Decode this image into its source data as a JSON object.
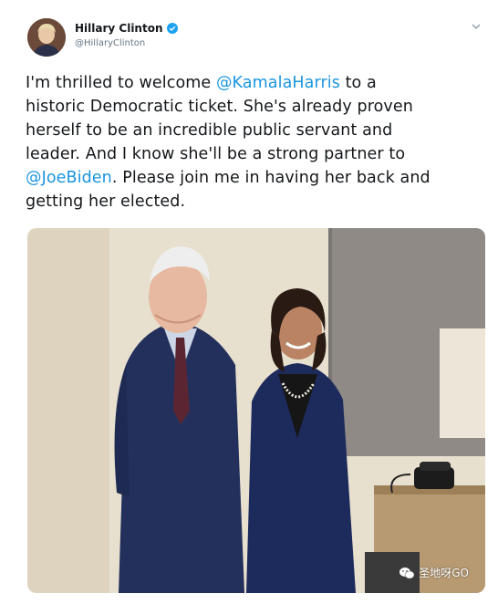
{
  "author": {
    "name": "Hillary Clinton",
    "handle": "@HillaryClinton"
  },
  "tweet": {
    "line1_a": "I'm thrilled to welcome ",
    "mention_1": "@KamalaHarris",
    "line1_b": " to a",
    "line2": "historic Democratic ticket. She's already proven",
    "line3": "herself to be an incredible public servant and",
    "line4": "leader. And I know she'll be a strong partner to",
    "mention_2": "@JoeBiden",
    "line5_b": ". Please join me in having her back and",
    "line6": "getting her elected."
  },
  "watermark": {
    "text": "圣地呀GO"
  },
  "colors": {
    "mention": "#1b95e0",
    "verified": "#1da1f2"
  },
  "icons": [
    "verified-badge-icon",
    "chevron-down-icon",
    "wechat-icon"
  ]
}
